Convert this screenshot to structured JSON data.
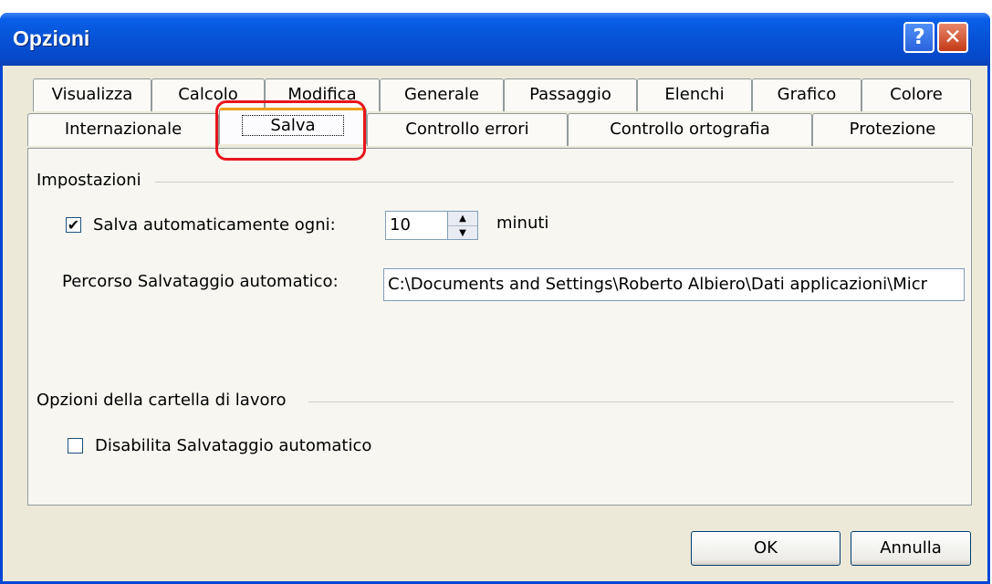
{
  "window": {
    "title": "Opzioni",
    "help_label": "?",
    "close_label": "✕"
  },
  "tabs_row1": [
    "Visualizza",
    "Calcolo",
    "Modifica",
    "Generale",
    "Passaggio",
    "Elenchi",
    "Grafico",
    "Colore"
  ],
  "tabs_row2": [
    "Internazionale",
    "Salva",
    "Controllo errori",
    "Controllo ortografia",
    "Protezione"
  ],
  "active_tab": "Salva",
  "settings": {
    "group_label": "Impostazioni",
    "autosave_checkbox": {
      "label": "Salva automaticamente ogni:",
      "checked": true
    },
    "interval_value": "10",
    "interval_unit": "minuti",
    "path_label": "Percorso Salvataggio automatico:",
    "path_value": "C:\\Documents and Settings\\Roberto Albiero\\Dati applicazioni\\Micr"
  },
  "workbook": {
    "group_label": "Opzioni della cartella di lavoro",
    "disable_checkbox": {
      "label": "Disabilita Salvataggio automatico",
      "checked": false
    }
  },
  "buttons": {
    "ok": "OK",
    "cancel": "Annulla"
  },
  "colors": {
    "titlebar": "#0752d6",
    "highlight": "#e8141c",
    "dialog_bg": "#ece9d8"
  }
}
